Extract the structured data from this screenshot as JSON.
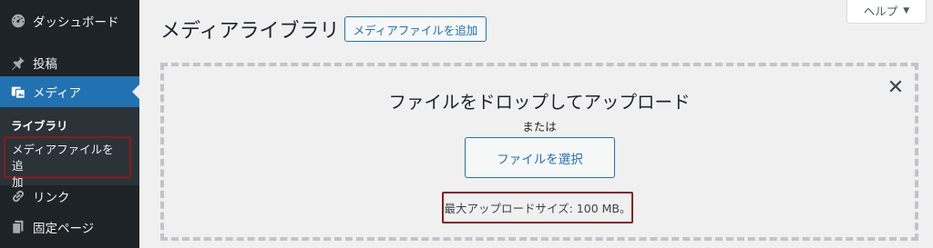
{
  "sidebar": {
    "items": [
      {
        "label": "ダッシュボード",
        "icon": "dashboard-icon"
      },
      {
        "label": "投稿",
        "icon": "pin-icon"
      },
      {
        "label": "メディア",
        "icon": "media-icon",
        "active": true
      },
      {
        "label": "リンク",
        "icon": "link-icon"
      },
      {
        "label": "固定ページ",
        "icon": "page-icon"
      }
    ],
    "submenu": {
      "library": "ライブラリ",
      "add_new_line1": "メディアファイルを追",
      "add_new_line2": "加"
    }
  },
  "header": {
    "title": "メディアライブラリ",
    "add_new_button": "メディアファイルを追加",
    "help_label": "ヘルプ",
    "help_caret": "▼"
  },
  "uploader": {
    "drop_title": "ファイルをドロップしてアップロード",
    "or_text": "または",
    "select_button": "ファイルを選択",
    "max_size": "最大アップロードサイズ: 100 MB。",
    "close_symbol": "✕"
  },
  "colors": {
    "sidebar_bg": "#1d2327",
    "accent": "#2271b1",
    "highlight_border": "#8b1a1a",
    "page_bg": "#f0f0f1"
  }
}
